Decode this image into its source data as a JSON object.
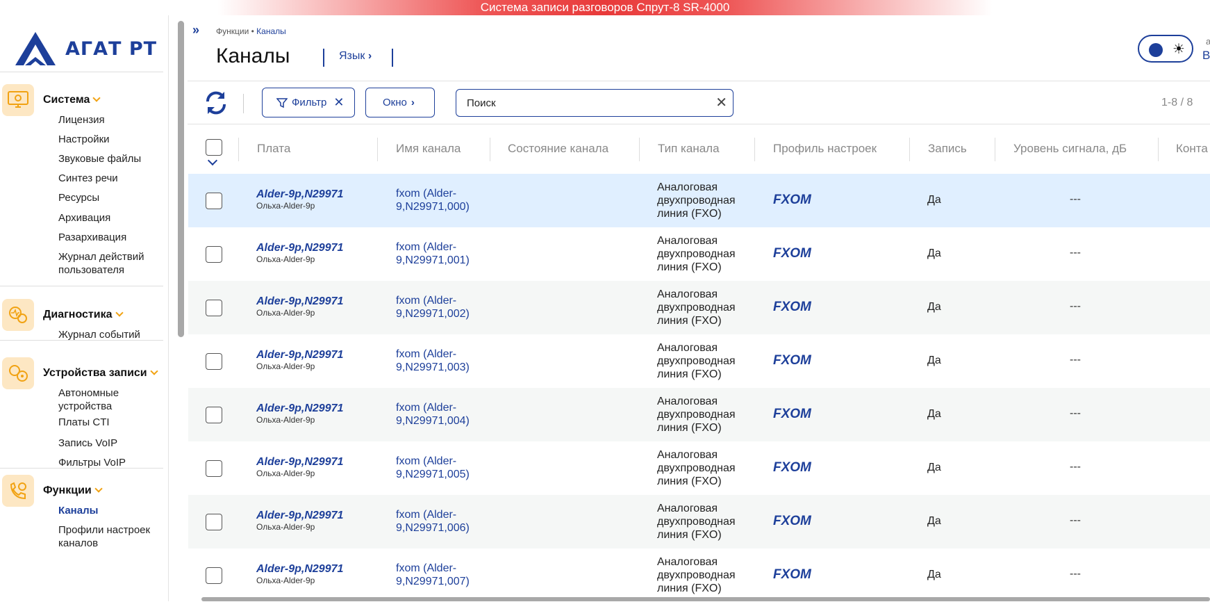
{
  "banner": {
    "text": "Система записи разговоров Спрут-8 SR-4000"
  },
  "logo": {
    "text": "АГАТ РТ"
  },
  "sidebar": {
    "sections": [
      {
        "title": "Система",
        "icon": "monitor-gear-icon",
        "items": [
          "Лицензия",
          "Настройки",
          "Звуковые файлы",
          "Синтез речи",
          "Ресурсы",
          "Архивация",
          "Разархивация",
          "Журнал действий пользователя"
        ]
      },
      {
        "title": "Диагностика",
        "icon": "diagnostics-icon",
        "items": [
          "Журнал событий"
        ]
      },
      {
        "title": "Устройства записи",
        "icon": "recording-devices-icon",
        "items": [
          "Автономные устройства",
          "Платы CTI",
          "Запись VoIP",
          "Фильтры VoIP"
        ]
      },
      {
        "title": "Функции",
        "icon": "phone-functions-icon",
        "items": [
          "Каналы",
          "Профили настроек каналов"
        ],
        "active_item": "Каналы"
      }
    ]
  },
  "header": {
    "breadcrumb": {
      "parent": "Функции",
      "separator": "•",
      "current": "Каналы"
    },
    "title": "Каналы",
    "language_label": "Язык",
    "user_letter": "В",
    "user_small": "а"
  },
  "toolbar": {
    "filter_label": "Фильтр",
    "window_label": "Окно",
    "search_value": "Поиск",
    "pager": "1-8 / 8"
  },
  "table": {
    "columns": [
      "Плата",
      "Имя канала",
      "Состояние канала",
      "Тип канала",
      "Профиль настроек",
      "Запись",
      "Уровень сигнала, дБ",
      "Конта"
    ],
    "rows": [
      {
        "plate": "Alder-9p,N29971",
        "plate_sub": "Ольха-Alder-9p",
        "channel": "fxom (Alder-9,N29971,000)",
        "state": "",
        "type": "Аналоговая двухпроводная линия (FXO)",
        "profile": "FXOM",
        "record": "Да",
        "signal": "---"
      },
      {
        "plate": "Alder-9p,N29971",
        "plate_sub": "Ольха-Alder-9p",
        "channel": "fxom (Alder-9,N29971,001)",
        "state": "",
        "type": "Аналоговая двухпроводная линия (FXO)",
        "profile": "FXOM",
        "record": "Да",
        "signal": "---"
      },
      {
        "plate": "Alder-9p,N29971",
        "plate_sub": "Ольха-Alder-9p",
        "channel": "fxom (Alder-9,N29971,002)",
        "state": "",
        "type": "Аналоговая двухпроводная линия (FXO)",
        "profile": "FXOM",
        "record": "Да",
        "signal": "---"
      },
      {
        "plate": "Alder-9p,N29971",
        "plate_sub": "Ольха-Alder-9p",
        "channel": "fxom (Alder-9,N29971,003)",
        "state": "",
        "type": "Аналоговая двухпроводная линия (FXO)",
        "profile": "FXOM",
        "record": "Да",
        "signal": "---"
      },
      {
        "plate": "Alder-9p,N29971",
        "plate_sub": "Ольха-Alder-9p",
        "channel": "fxom (Alder-9,N29971,004)",
        "state": "",
        "type": "Аналоговая двухпроводная линия (FXO)",
        "profile": "FXOM",
        "record": "Да",
        "signal": "---"
      },
      {
        "plate": "Alder-9p,N29971",
        "plate_sub": "Ольха-Alder-9p",
        "channel": "fxom (Alder-9,N29971,005)",
        "state": "",
        "type": "Аналоговая двухпроводная линия (FXO)",
        "profile": "FXOM",
        "record": "Да",
        "signal": "---"
      },
      {
        "plate": "Alder-9p,N29971",
        "plate_sub": "Ольха-Alder-9p",
        "channel": "fxom (Alder-9,N29971,006)",
        "state": "",
        "type": "Аналоговая двухпроводная линия (FXO)",
        "profile": "FXOM",
        "record": "Да",
        "signal": "---"
      },
      {
        "plate": "Alder-9p,N29971",
        "plate_sub": "Ольха-Alder-9p",
        "channel": "fxom (Alder-9,N29971,007)",
        "state": "",
        "type": "Аналоговая двухпроводная линия (FXO)",
        "profile": "FXOM",
        "record": "Да",
        "signal": "---"
      }
    ]
  },
  "colors": {
    "accent": "#1d3f9a",
    "banner": "#e83a3a",
    "section_icon_bg": "#fde7c3",
    "chevron": "#f1a212",
    "selected_row": "#e0efff"
  }
}
